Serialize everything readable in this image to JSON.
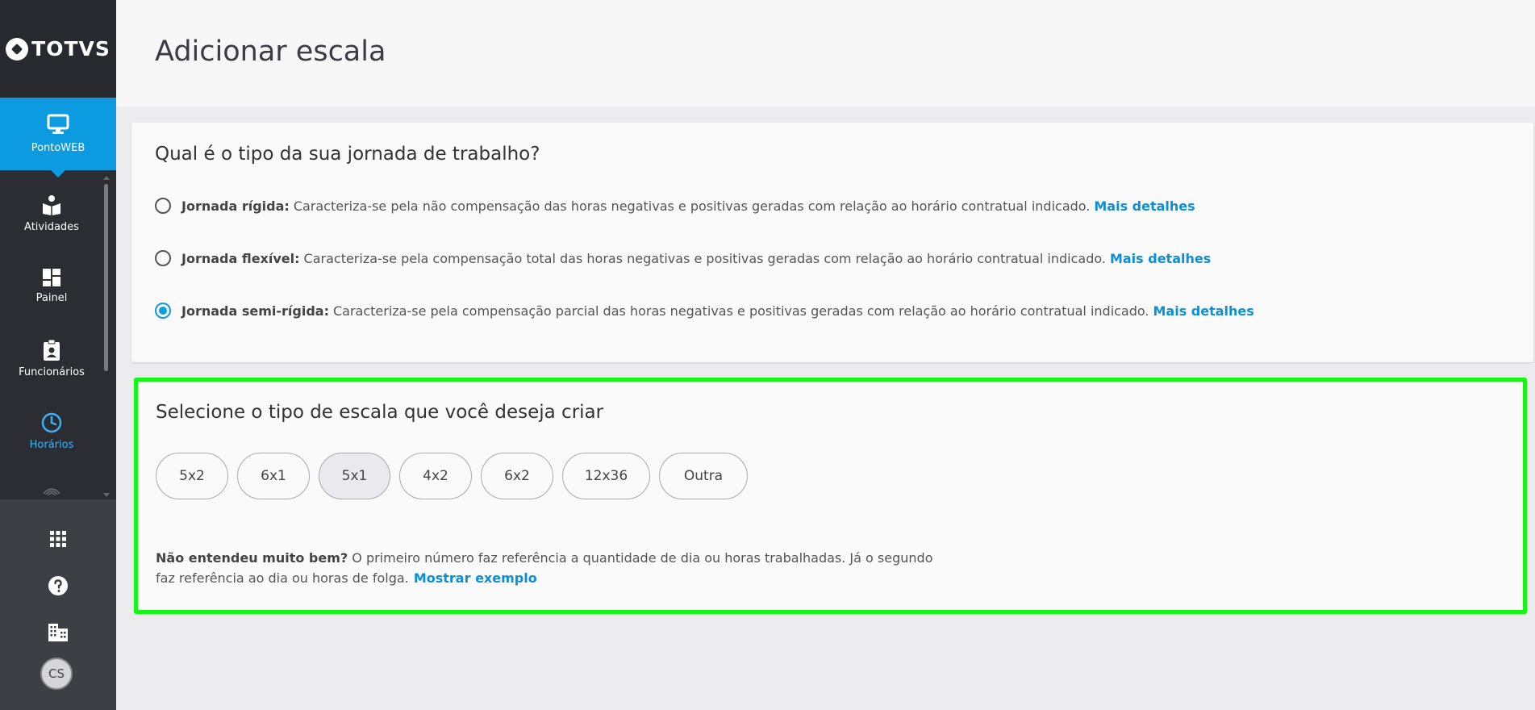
{
  "brand": {
    "logo_text": "TOTVS"
  },
  "sidebar": {
    "active_module": "PontoWEB",
    "items": [
      {
        "label": "Atividades",
        "icon": "book-reader-icon"
      },
      {
        "label": "Painel",
        "icon": "dashboard-icon"
      },
      {
        "label": "Funcionários",
        "icon": "badge-icon"
      },
      {
        "label": "Horários",
        "icon": "clock-icon"
      }
    ],
    "bottom": [
      {
        "icon": "apps-grid-icon"
      },
      {
        "icon": "help-icon"
      },
      {
        "icon": "building-icon"
      }
    ],
    "avatar_initials": "CS"
  },
  "page": {
    "title": "Adicionar escala"
  },
  "journey": {
    "question": "Qual é o tipo da sua jornada de trabalho?",
    "options": [
      {
        "title": "Jornada rígida:",
        "description": "Caracteriza-se pela não compensação das horas negativas e positivas geradas com relação ao horário contratual indicado.",
        "link": "Mais detalhes",
        "checked": false
      },
      {
        "title": "Jornada flexível:",
        "description": "Caracteriza-se pela compensação total das horas negativas e positivas geradas com relação ao horário contratual indicado.",
        "link": "Mais detalhes",
        "checked": false
      },
      {
        "title": "Jornada semi-rígida:",
        "description": "Caracteriza-se pela compensação parcial das horas negativas e positivas geradas com relação ao horário contratual indicado.",
        "link": "Mais detalhes",
        "checked": true
      }
    ]
  },
  "scale": {
    "question": "Selecione o tipo de escala que você deseja criar",
    "chips": [
      "5x2",
      "6x1",
      "5x1",
      "4x2",
      "6x2",
      "12x36",
      "Outra"
    ],
    "selected": "5x1",
    "help_strong": "Não entendeu muito bem?",
    "help_text": "O primeiro número faz referência a quantidade de dia ou horas trabalhadas. Já o segundo faz referência ao dia ou horas de folga.",
    "help_link": "Mostrar exemplo"
  },
  "colors": {
    "accent": "#0c9be0",
    "sidebar": "#2b2d33",
    "highlight_border": "#18f318"
  }
}
